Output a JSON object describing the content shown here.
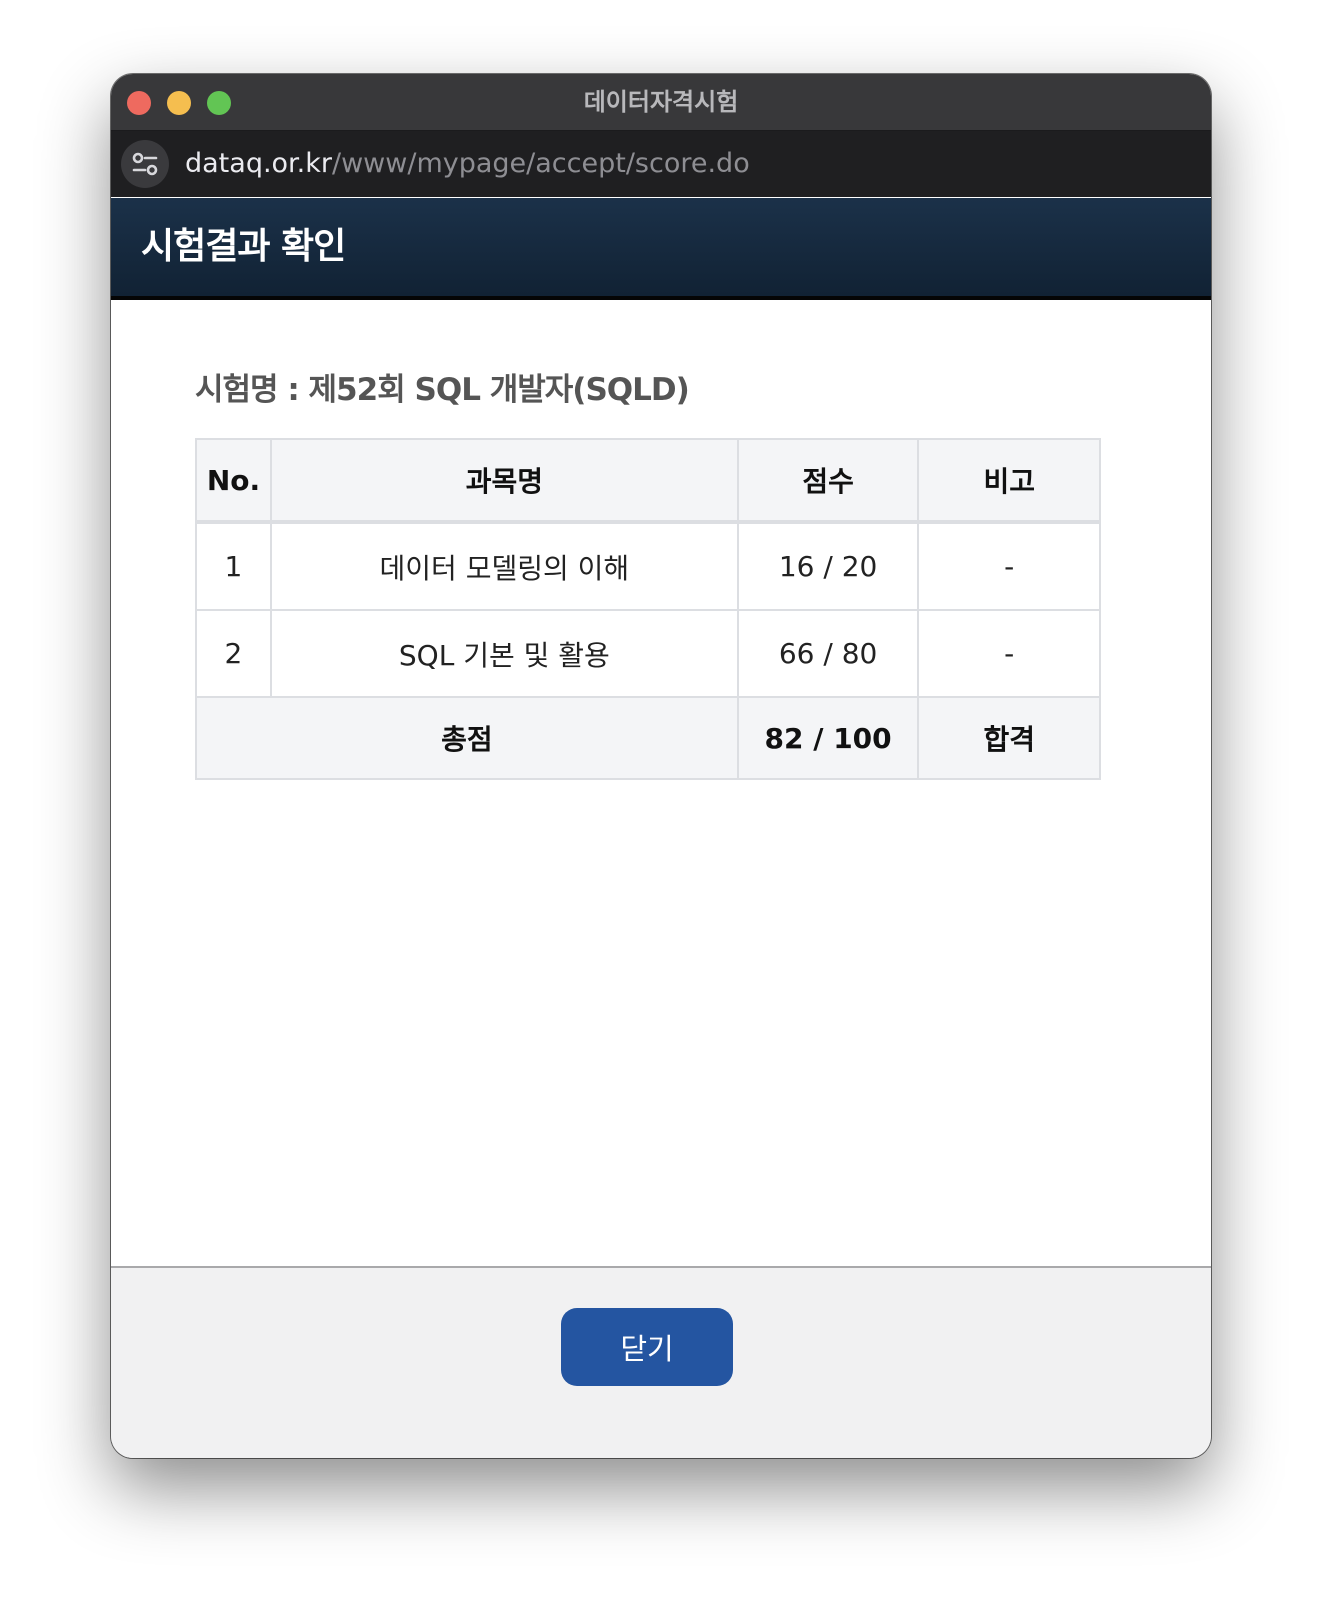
{
  "window": {
    "title": "데이터자격시험"
  },
  "address_bar": {
    "url_host": "dataq.or.kr",
    "url_path": "/www/mypage/accept/score.do"
  },
  "page": {
    "title": "시험결과 확인",
    "exam_name": "시험명 : 제52회 SQL 개발자(SQLD)"
  },
  "table": {
    "headers": [
      "No.",
      "과목명",
      "점수",
      "비고"
    ],
    "rows": [
      {
        "no": "1",
        "subject": "데이터 모델링의 이해",
        "score": "16 / 20",
        "note": "-"
      },
      {
        "no": "2",
        "subject": "SQL 기본 및 활용",
        "score": "66 / 80",
        "note": "-"
      }
    ],
    "total": {
      "label": "총점",
      "score": "82 / 100",
      "result": "합격"
    }
  },
  "footer": {
    "close_label": "닫기"
  },
  "colors": {
    "header_bg": "#1b3149",
    "button": "#2455a1",
    "traffic_close": "#ee6a5f",
    "traffic_minimize": "#f5be4f",
    "traffic_maximize": "#62c554"
  }
}
